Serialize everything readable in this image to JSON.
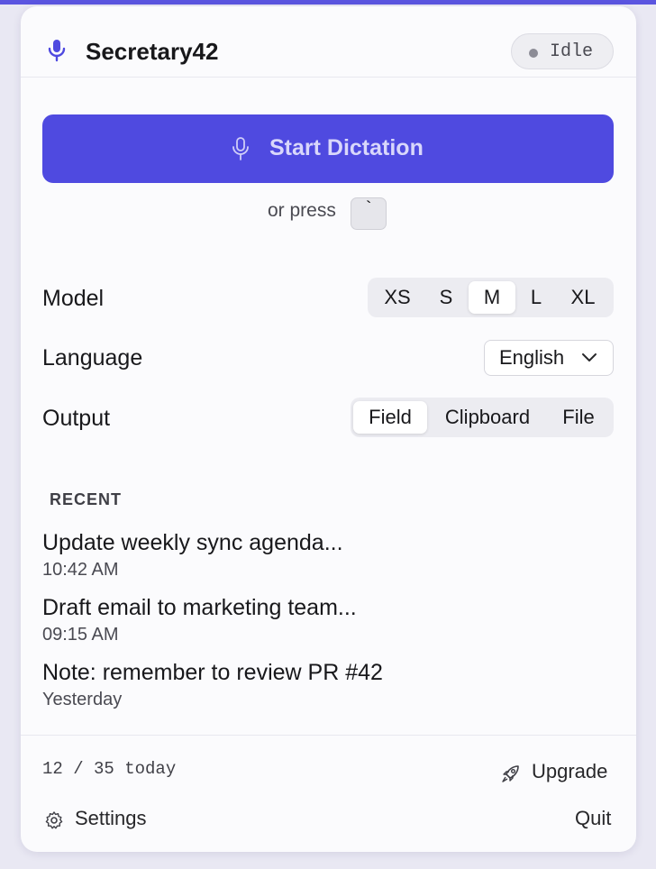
{
  "app": {
    "title": "Secretary42",
    "status": "Idle"
  },
  "dictation": {
    "start_label": "Start Dictation",
    "hint_prefix": "or press",
    "hotkey": "`"
  },
  "settings": {
    "model": {
      "label": "Model",
      "options": [
        "XS",
        "S",
        "M",
        "L",
        "XL"
      ],
      "selected": "M"
    },
    "language": {
      "label": "Language",
      "value": "English"
    },
    "output": {
      "label": "Output",
      "options": [
        "Field",
        "Clipboard",
        "File"
      ],
      "selected": "Field"
    }
  },
  "recent": {
    "title": "RECENT",
    "items": [
      {
        "text": "Update weekly sync agenda...",
        "time": "10:42 AM"
      },
      {
        "text": "Draft email to marketing team...",
        "time": "09:15 AM"
      },
      {
        "text": "Note: remember to review PR #42",
        "time": "Yesterday"
      }
    ]
  },
  "footer": {
    "usage": "12 / 35 today",
    "upgrade": "Upgrade",
    "settings": "Settings",
    "quit": "Quit"
  },
  "colors": {
    "accent": "#4f4ae0",
    "accent_text": "#d9d7fb",
    "topbar": "#5b55e0"
  },
  "icons": {
    "header": "microphone-icon",
    "start": "microphone-icon",
    "status": "status-dot",
    "language": "chevron-down-icon",
    "upgrade": "rocket-icon",
    "settings": "gear-icon"
  }
}
